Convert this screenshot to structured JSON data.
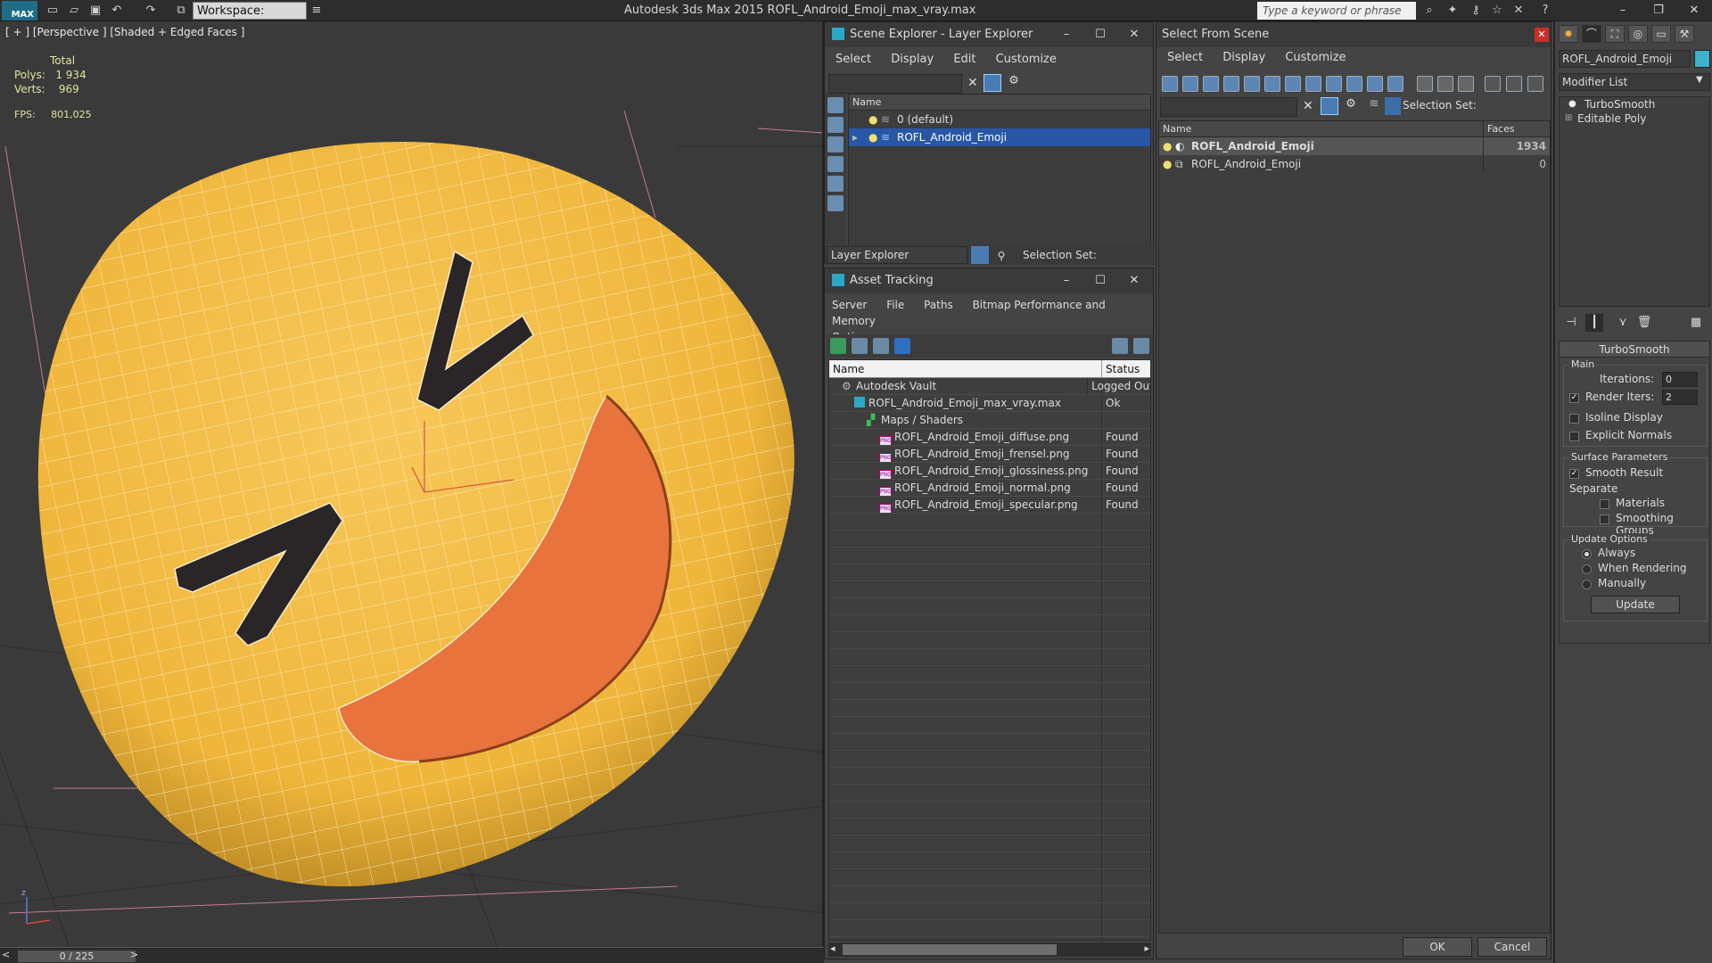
{
  "titlebar": {
    "logo": "MAX",
    "workspace": "Workspace: Default",
    "app_title": "Autodesk 3ds Max  2015     ROFL_Android_Emoji_max_vray.max",
    "search_placeholder": "Type a keyword or phrase"
  },
  "viewport": {
    "label": "[ + ] [Perspective ] [Shaded + Edged Faces ]",
    "stats_total": "Total",
    "polys_label": "Polys:",
    "polys_value": "1 934",
    "verts_label": "Verts:",
    "verts_value": "969",
    "fps_label": "FPS:",
    "fps_value": "801,025",
    "timeline": "0 / 225"
  },
  "scene_explorer": {
    "title": "Scene Explorer - Layer Explorer",
    "menu": [
      "Select",
      "Display",
      "Edit",
      "Customize"
    ],
    "column_name": "Name",
    "rows": [
      {
        "label": "0 (default)",
        "selected": false
      },
      {
        "label": "ROFL_Android_Emoji",
        "selected": true
      }
    ],
    "footer_dropdown": "Layer Explorer",
    "footer_selset": "Selection Set:"
  },
  "asset_tracking": {
    "title": "Asset Tracking",
    "menu": [
      "Server",
      "File",
      "Paths",
      "Bitmap Performance and Memory",
      "Options"
    ],
    "col_name": "Name",
    "col_status": "Status",
    "rows": [
      {
        "name": "Autodesk Vault",
        "status": "Logged Out",
        "indent": 1,
        "icon": "vault"
      },
      {
        "name": "ROFL_Android_Emoji_max_vray.max",
        "status": "Ok",
        "indent": 2,
        "icon": "max"
      },
      {
        "name": "Maps / Shaders",
        "status": "",
        "indent": 3,
        "icon": "maps"
      },
      {
        "name": "ROFL_Android_Emoji_diffuse.png",
        "status": "Found",
        "indent": 4,
        "icon": "png"
      },
      {
        "name": "ROFL_Android_Emoji_frensel.png",
        "status": "Found",
        "indent": 4,
        "icon": "png"
      },
      {
        "name": "ROFL_Android_Emoji_glossiness.png",
        "status": "Found",
        "indent": 4,
        "icon": "png"
      },
      {
        "name": "ROFL_Android_Emoji_normal.png",
        "status": "Found",
        "indent": 4,
        "icon": "png"
      },
      {
        "name": "ROFL_Android_Emoji_specular.png",
        "status": "Found",
        "indent": 4,
        "icon": "png"
      }
    ]
  },
  "select_from_scene": {
    "title": "Select From Scene",
    "menu": [
      "Select",
      "Display",
      "Customize"
    ],
    "selection_set": "Selection Set:",
    "col_name": "Name",
    "col_faces": "Faces",
    "rows": [
      {
        "name": "ROFL_Android_Emoji",
        "faces": "1934",
        "selected": true
      },
      {
        "name": "ROFL_Android_Emoji",
        "faces": "0",
        "selected": false
      }
    ],
    "ok": "OK",
    "cancel": "Cancel"
  },
  "command_panel": {
    "object_name": "ROFL_Android_Emoji",
    "object_color": "#3ab3cc",
    "modifier_list": "Modifier List",
    "stack": [
      "TurboSmooth",
      "Editable Poly"
    ],
    "rollout_title": "TurboSmooth",
    "main_label": "Main",
    "iterations_label": "Iterations:",
    "iterations_value": "0",
    "render_iters_label": "Render Iters:",
    "render_iters_value": "2",
    "isoline_display": "Isoline Display",
    "explicit_normals": "Explicit Normals",
    "surface_params": "Surface Parameters",
    "smooth_result": "Smooth Result",
    "separate": "Separate",
    "materials": "Materials",
    "smoothing_groups": "Smoothing Groups",
    "update_options": "Update Options",
    "always": "Always",
    "when_rendering": "When Rendering",
    "manually": "Manually",
    "update_button": "Update"
  }
}
